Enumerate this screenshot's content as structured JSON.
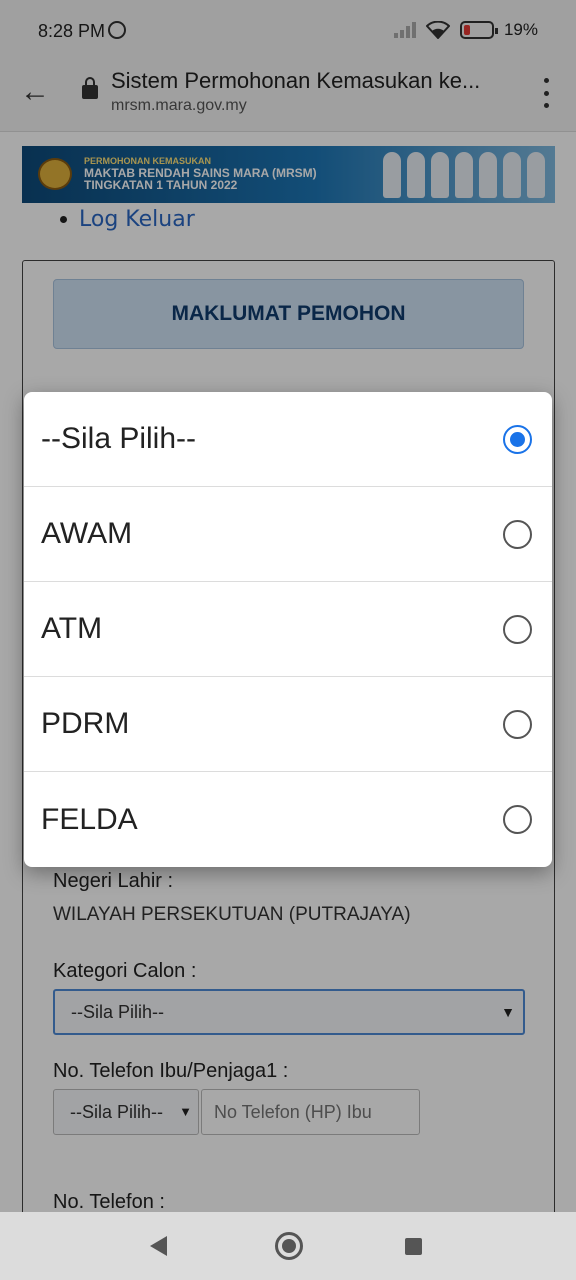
{
  "status_bar": {
    "time": "8:28 PM",
    "battery": "19%",
    "icons": [
      "whatsapp-icon",
      "signal-icon",
      "wifi-icon",
      "battery-icon"
    ]
  },
  "browser": {
    "title": "Sistem Permohonan Kemasukan ke...",
    "domain": "mrsm.mara.gov.my"
  },
  "page": {
    "banner": {
      "line1": "PERMOHONAN KEMASUKAN",
      "line2": "MAKTAB RENDAH SAINS MARA (MRSM)",
      "line3": "TINGKATAN 1 TAHUN 2022"
    },
    "logout": "Log Keluar",
    "section_title": "MAKLUMAT PEMOHON",
    "negeri_lahir_label": "Negeri Lahir :",
    "negeri_lahir_value": "WILAYAH PERSEKUTUAN (PUTRAJAYA)",
    "kategori_label": "Kategori Calon :",
    "kategori_value": "--Sila Pilih--",
    "telefon_ibu_label": "No. Telefon Ibu/Penjaga1 :",
    "telefon_prefix_value": "--Sila Pilih--",
    "telefon_placeholder": "No Telefon (HP) Ibu",
    "telefon_label": "No. Telefon :"
  },
  "dialog": {
    "options": [
      {
        "label": "--Sila Pilih--",
        "selected": true
      },
      {
        "label": "AWAM",
        "selected": false
      },
      {
        "label": "ATM",
        "selected": false
      },
      {
        "label": "PDRM",
        "selected": false
      },
      {
        "label": "FELDA",
        "selected": false
      }
    ],
    "accent_color": "#1a73e8"
  }
}
